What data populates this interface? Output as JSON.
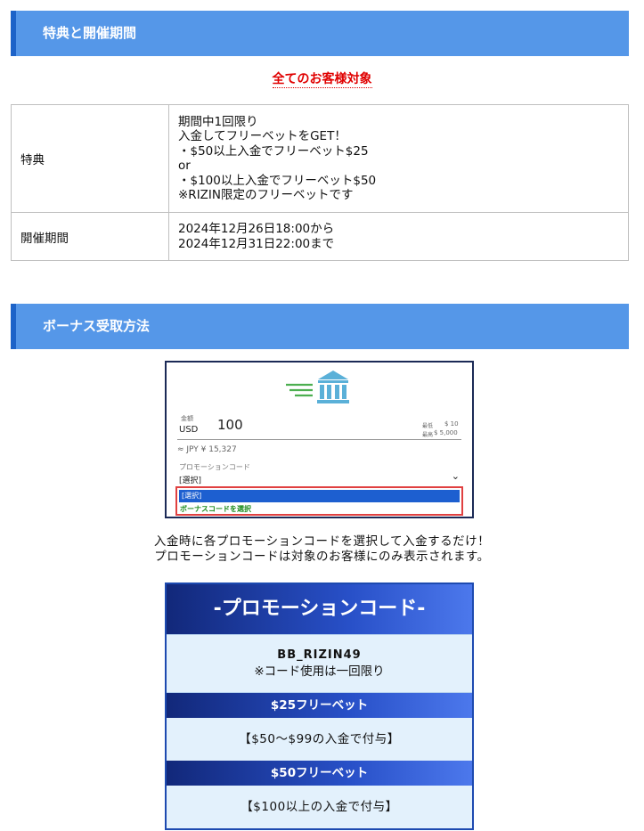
{
  "section1": {
    "title": "特典と開催期間"
  },
  "target_note": "全てのお客様対象",
  "info_table": {
    "bonus_label": "特典",
    "bonus_lines": [
      "期間中1回限り",
      "入金してフリーベットをGET！",
      "・$50以上入金でフリーベット$25",
      "or",
      "・$100以上入金でフリーベット$50",
      "※RIZIN限定のフリーベットです"
    ],
    "period_label": "開催期間",
    "period_lines": [
      "2024年12月26日18:00から",
      "2024年12月31日22:00まで"
    ]
  },
  "section2": {
    "title": "ボーナス受取方法"
  },
  "screenshot": {
    "amount_label": "金額",
    "currency": "USD",
    "amount": "100",
    "min_label": "最低",
    "min_value": "$ 10",
    "max_label": "最高",
    "max_value": "$ 5,000",
    "jpy_equiv": "≈ JPY ¥ 15,327",
    "promo_label": "プロモーションコード",
    "select_value": "[選択]",
    "options": [
      "[選択]",
      "ボーナスコードを選択"
    ],
    "colors": {
      "bank": "#5ab0d8",
      "lines": "#4caf50",
      "highlight": "#e04040"
    }
  },
  "description": [
    "入金時に各プロモーションコードを選択して入金するだけ！",
    "プロモーションコードは対象のお客様にのみ表示されます。"
  ],
  "promo": {
    "title": "-プロモーションコード-",
    "code": "BB_RIZIN49",
    "code_note": "※コード使用は一回限り",
    "tiers": [
      {
        "title": "$25フリーベット",
        "condition": "【$50～$99の入金で付与】"
      },
      {
        "title": "$50フリーベット",
        "condition": "【$100以上の入金で付与】"
      }
    ]
  }
}
